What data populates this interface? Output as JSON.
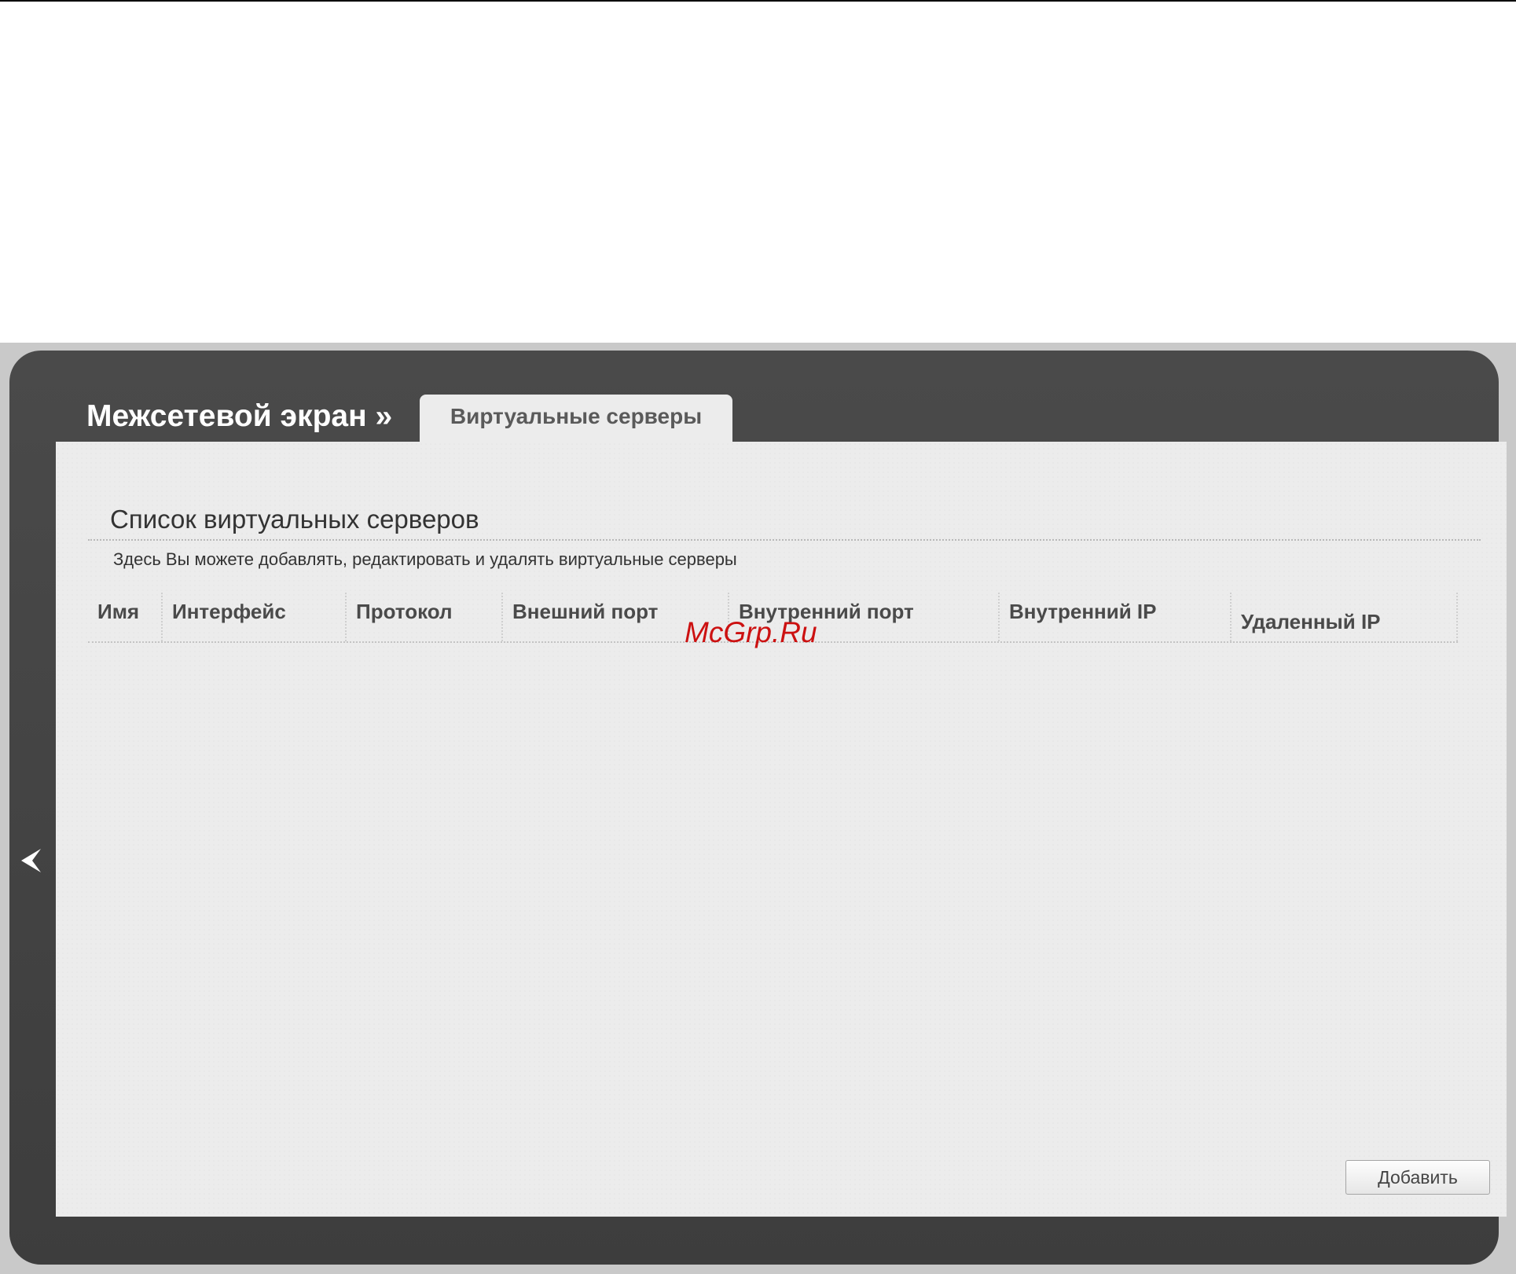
{
  "header": {
    "section_title": "Межсетевой экран »",
    "active_tab": "Виртуальные серверы"
  },
  "panel": {
    "heading": "Список виртуальных серверов",
    "description": "Здесь Вы можете добавлять, редактировать и удалять виртуальные серверы"
  },
  "table": {
    "columns": [
      "Имя",
      "Интерфейс",
      "Протокол",
      "Внешний порт",
      "Внутренний порт",
      "Внутренний IP",
      "Удаленный IP"
    ],
    "rows": []
  },
  "watermark": "McGrp.Ru",
  "buttons": {
    "add_label": "Добавить"
  },
  "icons": {
    "back": "chevron-left-icon"
  },
  "colors": {
    "frame": "#444444",
    "panel": "#ececec",
    "watermark": "#cc1111"
  }
}
